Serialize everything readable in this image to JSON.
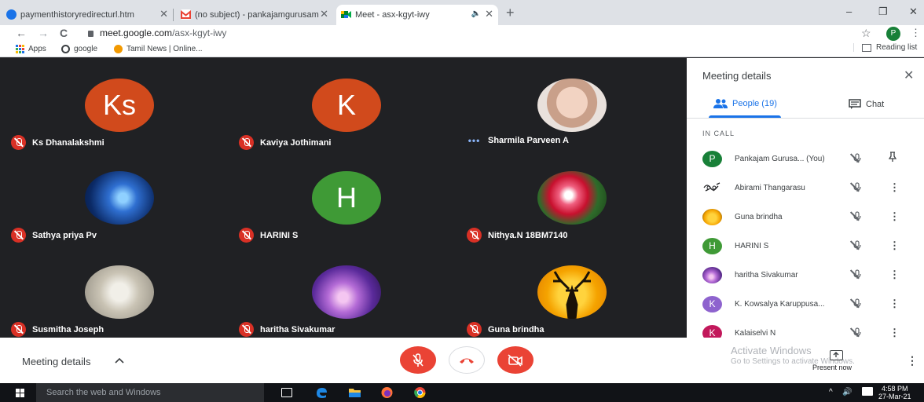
{
  "browser": {
    "tabs": [
      {
        "title": "paymenthistoryredirecturl.htm",
        "close": "✕",
        "favicon": "info-icon",
        "color": "#1a73e8"
      },
      {
        "title": "(no subject) - pankajamgurusam",
        "close": "✕",
        "favicon": "gmail-icon",
        "color": "#ea4335"
      },
      {
        "title": "Meet - asx-kgyt-iwy",
        "close": "✕",
        "favicon": "meet-icon",
        "color": "#00832d",
        "audio": "🔈"
      }
    ],
    "new_tab": "+",
    "window_controls": [
      "–",
      "❐",
      "✕"
    ],
    "nav": {
      "back": "←",
      "forward": "→",
      "reload": "C"
    },
    "url_host": "meet.google.com",
    "url_path": "/asx-kgyt-iwy",
    "star": "☆",
    "profile_initial": "P",
    "menu": "⋮",
    "bookmarks": [
      {
        "label": "Apps",
        "icon": "apps-grid-icon",
        "color": "#1a73e8"
      },
      {
        "label": "google",
        "icon": "globe-icon",
        "color": "#3c4043"
      },
      {
        "label": "Tamil News | Online...",
        "icon": "news-icon",
        "color": "#f29900"
      }
    ],
    "reading_list": "Reading list"
  },
  "stage": {
    "tiles": [
      {
        "name": "Ks Dhanalakshmi",
        "initials": "Ks",
        "avatar_type": "initials",
        "color": "#d14a1c",
        "status": "muted"
      },
      {
        "name": "Kaviya Jothimani",
        "initials": "K",
        "avatar_type": "initials",
        "color": "#d14a1c",
        "status": "muted"
      },
      {
        "name": "Sharmila Parveen A",
        "initials": "",
        "avatar_type": "photo-child",
        "status": "speaking",
        "status_text": "•••"
      },
      {
        "name": "Sathya priya Pv",
        "initials": "",
        "avatar_type": "photo-blue-night",
        "status": "muted"
      },
      {
        "name": "HARINI S",
        "initials": "H",
        "avatar_type": "initials",
        "color": "#3f9a36",
        "status": "muted"
      },
      {
        "name": "Nithya.N 18BM7140",
        "initials": "",
        "avatar_type": "photo-rose",
        "status": "muted"
      },
      {
        "name": "Susmitha Joseph",
        "initials": "",
        "avatar_type": "photo-baby",
        "status": "muted"
      },
      {
        "name": "haritha Sivakumar",
        "initials": "",
        "avatar_type": "photo-purple-night",
        "status": "muted"
      },
      {
        "name": "Guna brindha",
        "initials": "",
        "avatar_type": "photo-deer-sunset",
        "status": "muted"
      }
    ]
  },
  "panel": {
    "title": "Meeting details",
    "close": "✕",
    "tabs": {
      "people": "People (19)",
      "chat": "Chat"
    },
    "section": "IN CALL",
    "participants": [
      {
        "name": "Pankajam Gurusa...",
        "suffix": "(You)",
        "initial": "P",
        "color": "#188038",
        "action": "pin-icon"
      },
      {
        "name": "Abirami Thangarasu",
        "initial": "",
        "avatar": "doodle-icon",
        "action": "more-vert-icon"
      },
      {
        "name": "Guna brindha",
        "initial": "",
        "avatar": "deer-photo",
        "action": "more-vert-icon"
      },
      {
        "name": "HARINI S",
        "initial": "H",
        "color": "#3f9a36",
        "action": "more-vert-icon"
      },
      {
        "name": "haritha Sivakumar",
        "initial": "",
        "avatar": "purple-photo",
        "action": "more-vert-icon"
      },
      {
        "name": "K. Kowsalya Karuppusa...",
        "initial": "K",
        "color": "#8e63ce",
        "action": "more-vert-icon"
      },
      {
        "name": "Kalaiselvi N",
        "initial": "K",
        "color": "#c2185b",
        "action": "more-vert-icon"
      }
    ],
    "more_glyph": "⋮",
    "mic_glyph": "🎙"
  },
  "bottom": {
    "meeting_details": "Meeting details",
    "caret": "^",
    "activate_title": "Activate Windows",
    "activate_sub": "Go to Settings to activate Windows.",
    "present_now": "Present now",
    "more": "⋮"
  },
  "taskbar": {
    "search_placeholder": "Search the web and Windows",
    "tray_caret": "^",
    "volume": "🔊",
    "time": "4:58 PM",
    "date": "27-Mar-21"
  }
}
